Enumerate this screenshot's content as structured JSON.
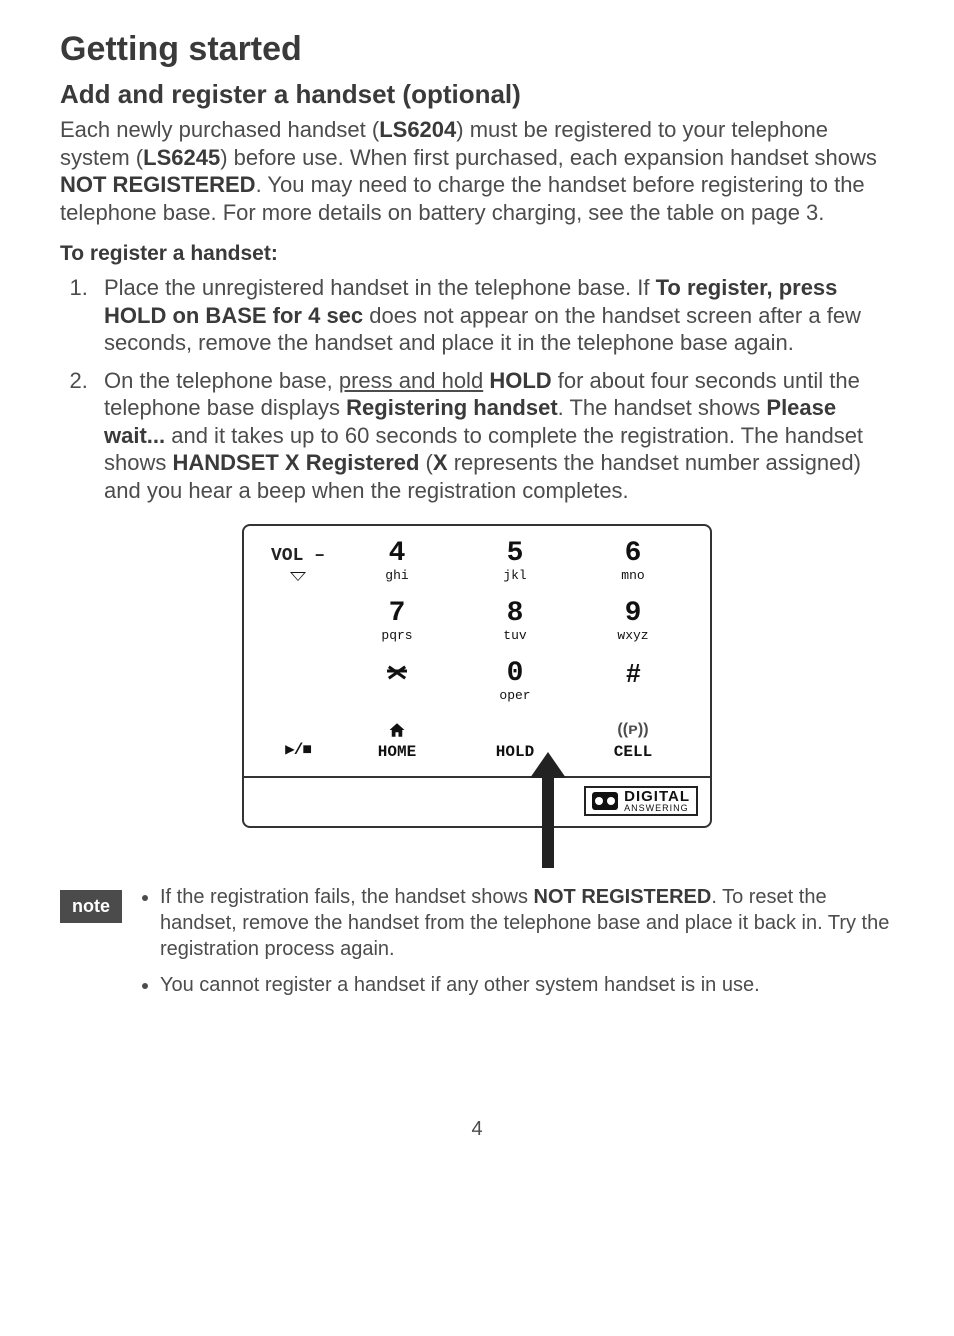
{
  "title": "Getting started",
  "section_title": "Add and register a handset (optional)",
  "intro_segments": {
    "a": "Each newly purchased handset (",
    "b": "LS6204",
    "c": ") must be registered to your telephone system (",
    "d": "LS6245",
    "e": ") before use. When first purchased, each expansion handset shows ",
    "f": "NOT REGISTERED",
    "g": ". You may need to charge the handset before registering to the telephone base. For more details on battery charging, see the table on page 3."
  },
  "subheading": "To register a handset:",
  "steps": {
    "s1": {
      "a": "Place the unregistered handset in the telephone base. If ",
      "b": "To register, press HOLD on BASE for 4 sec",
      "c": " does not appear on the handset screen after a few seconds, remove the handset and place it in the telephone base again."
    },
    "s2": {
      "a": "On the telephone base, ",
      "b": "press and hold",
      "c": " ",
      "d": "HOLD",
      "e": " for about four seconds until the telephone base displays ",
      "f": "Registering handset",
      "g": ". The handset shows ",
      "h": "Please wait...",
      "i": " and it takes up to 60 seconds to complete the registration. The handset shows ",
      "j": "HANDSET X Registered",
      "k": " (",
      "l": "X",
      "m": " represents the handset number assigned) and you hear a beep when the registration completes."
    }
  },
  "keypad": {
    "vol_minus": "VOL –",
    "four": "4",
    "four_sub": "ghi",
    "five": "5",
    "five_sub": "jkl",
    "six": "6",
    "six_sub": "mno",
    "seven": "7",
    "seven_sub": "pqrs",
    "eight": "8",
    "eight_sub": "tuv",
    "nine": "9",
    "nine_sub": "wxyz",
    "zero": "0",
    "zero_sub": "oper",
    "hash": "#",
    "playstop": "▶/■",
    "home": "HOME",
    "hold": "HOLD",
    "cell": "CELL",
    "cell_icon": "((ᴩ))",
    "digital_top": "DIGITAL",
    "digital_bottom": "ANSWERING"
  },
  "note_label": "note",
  "notes": {
    "n1a": "If the registration fails, the handset shows ",
    "n1b": "NOT REGISTERED",
    "n1c": ". To reset the handset, remove the handset from the telephone base and place it back in. Try the registration process again.",
    "n2": "You cannot register a handset if any other system handset is in use."
  },
  "page_number": "4"
}
